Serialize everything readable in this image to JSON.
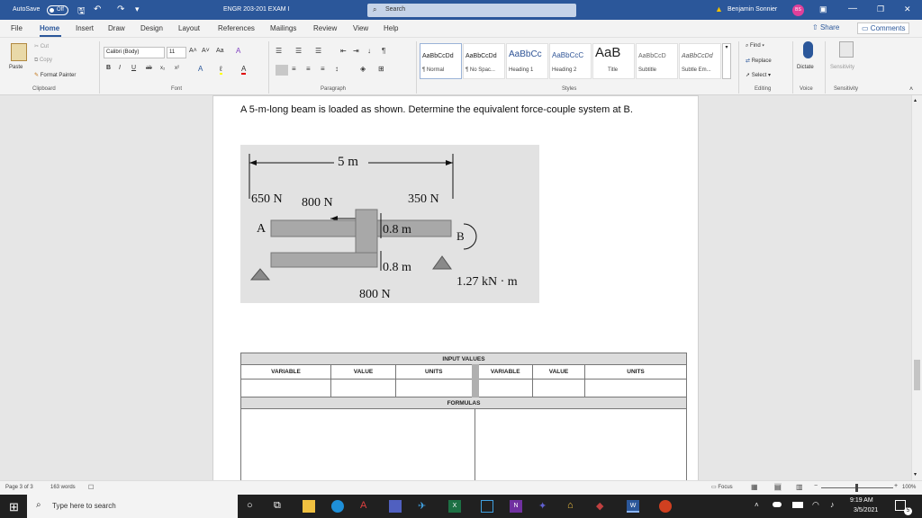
{
  "titlebar": {
    "autosave_label": "AutoSave",
    "autosave_state": "Off",
    "doc_title": "ENGR 203-201 EXAM I",
    "search_placeholder": "Search",
    "user_name": "Benjamin Sonnier",
    "user_initials": "BS",
    "minimize_glyph": "—",
    "restore_glyph": "❐",
    "close_glyph": "✕"
  },
  "menu": {
    "items": [
      "File",
      "Home",
      "Insert",
      "Draw",
      "Design",
      "Layout",
      "References",
      "Mailings",
      "Review",
      "View",
      "Help"
    ],
    "share_label": "Share",
    "comments_label": "Comments"
  },
  "ribbon": {
    "clipboard": {
      "paste": "Paste",
      "cut": "Cut",
      "copy": "Copy",
      "format_painter": "Format Painter",
      "label": "Clipboard"
    },
    "font": {
      "name": "Calibri (Body)",
      "size": "11",
      "label": "Font"
    },
    "paragraph": {
      "label": "Paragraph"
    },
    "styles": {
      "label": "Styles",
      "items": [
        {
          "sample": "AaBbCcDd",
          "name": "¶ Normal"
        },
        {
          "sample": "AaBbCcDd",
          "name": "¶ No Spac..."
        },
        {
          "sample": "AaBbCc",
          "name": "Heading 1"
        },
        {
          "sample": "AaBbCcC",
          "name": "Heading 2"
        },
        {
          "sample": "AaB",
          "name": "Title"
        },
        {
          "sample": "AaBbCcD",
          "name": "Subtitle"
        },
        {
          "sample": "AaBbCcDd",
          "name": "Subtle Em..."
        }
      ]
    },
    "editing": {
      "find": "Find",
      "replace": "Replace",
      "select": "Select",
      "label": "Editing"
    },
    "voice": {
      "dictate": "Dictate",
      "label": "Voice"
    },
    "sensitivity": {
      "button": "Sensitivity",
      "label": "Sensitivity"
    }
  },
  "document": {
    "question": "A 5-m-long beam is loaded as shown. Determine the equivalent force-couple system at B.",
    "figure": {
      "length": "5 m",
      "force_650": "650 N",
      "force_800_top": "800 N",
      "force_350": "350 N",
      "point_a": "A",
      "point_b": "B",
      "dim_top": "0.8 m",
      "dim_bottom": "0.8 m",
      "moment": "1.27 kN · m",
      "force_800_bottom": "800 N"
    },
    "table": {
      "input_title": "INPUT VALUES",
      "headers": [
        "VARIABLE",
        "VALUE",
        "UNITS",
        "VARIABLE",
        "VALUE",
        "UNITS"
      ],
      "formulas_title": "FORMULAS"
    }
  },
  "status": {
    "page": "Page 3 of 3",
    "words": "163 words",
    "focus": "Focus",
    "zoom": "100%"
  },
  "taskbar": {
    "search_placeholder": "Type here to search",
    "time": "9:19 AM",
    "date": "3/5/2021",
    "notification_count": "5"
  },
  "colors": {
    "word_blue": "#2b579a",
    "taskbar": "#202020"
  }
}
